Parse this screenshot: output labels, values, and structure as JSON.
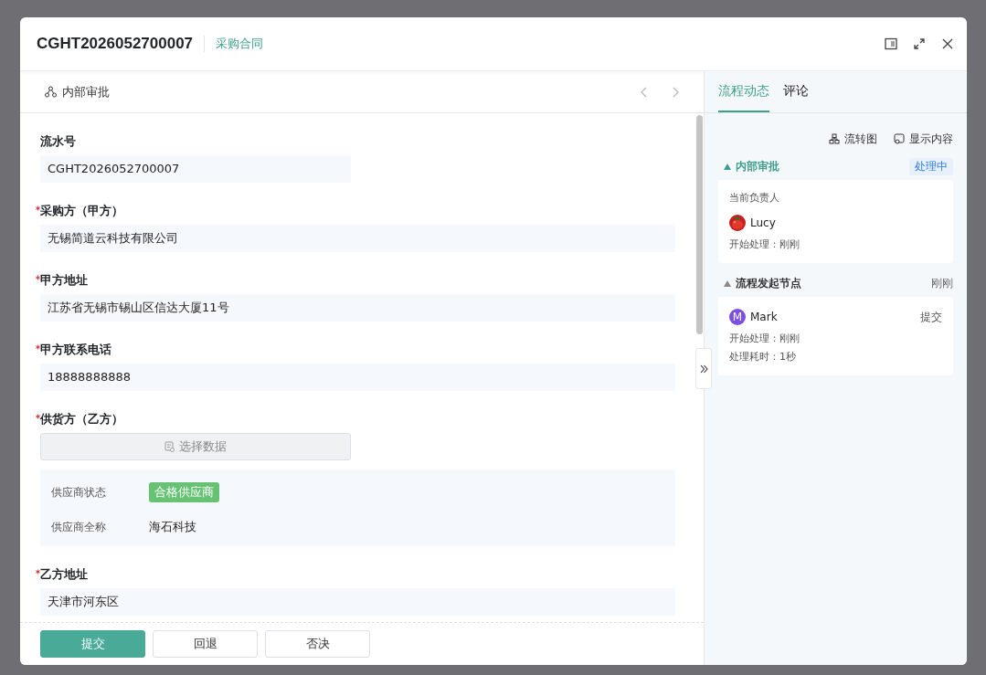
{
  "dialog": {
    "title": "CGHT2026052700007",
    "form_type": "采购合同"
  },
  "form_panel": {
    "node": "内部审批",
    "fields": [
      {
        "kind": "text",
        "label": "流水号",
        "required": false,
        "wide": false,
        "value": "CGHT2026052700007"
      },
      {
        "kind": "text",
        "label": "采购方（甲方）",
        "required": true,
        "wide": true,
        "value": "无锡简道云科技有限公司"
      },
      {
        "kind": "text",
        "label": "甲方地址",
        "required": true,
        "wide": true,
        "value": "江苏省无锡市锡山区信达大厦11号"
      },
      {
        "kind": "text",
        "label": "甲方联系电话",
        "required": true,
        "wide": true,
        "value": "18888888888"
      },
      {
        "kind": "picker",
        "label": "供货方（乙方）",
        "required": true,
        "wide": false,
        "button": "选择数据",
        "details": [
          {
            "kind": "tag",
            "label": "供应商状态",
            "value": "合格供应商"
          },
          {
            "kind": "text",
            "label": "供应商全称",
            "value": "海石科技"
          }
        ]
      },
      {
        "kind": "text",
        "label": "乙方地址",
        "required": true,
        "wide": true,
        "value": "天津市河东区"
      }
    ],
    "buttons": [
      {
        "label": "提交",
        "primary": true
      },
      {
        "label": "回退",
        "primary": false
      },
      {
        "label": "否决",
        "primary": false
      }
    ]
  },
  "flow_panel": {
    "tabs": [
      {
        "label": "流程动态",
        "selected": true
      },
      {
        "label": "评论",
        "selected": false
      }
    ],
    "tools": [
      {
        "kind": "chart",
        "label": "流转图"
      },
      {
        "kind": "content",
        "label": "显示内容"
      }
    ],
    "nodes": [
      {
        "name": "内部审批",
        "current": true,
        "status": "处理中",
        "card": [
          {
            "kind": "caption",
            "text": "当前负责人"
          },
          {
            "kind": "person",
            "name": "Lucy"
          },
          {
            "kind": "line",
            "text": "开始处理：刚刚"
          }
        ]
      },
      {
        "name": "流程发起节点",
        "current": false,
        "status": "刚刚",
        "card": [
          {
            "kind": "person",
            "avatar": {
              "kind": "letter",
              "text": "M"
            },
            "name": "Mark",
            "action": "提交"
          },
          {
            "kind": "line",
            "text": "开始处理：刚刚"
          },
          {
            "kind": "line",
            "text": "处理耗时：1秒"
          }
        ]
      }
    ]
  }
}
